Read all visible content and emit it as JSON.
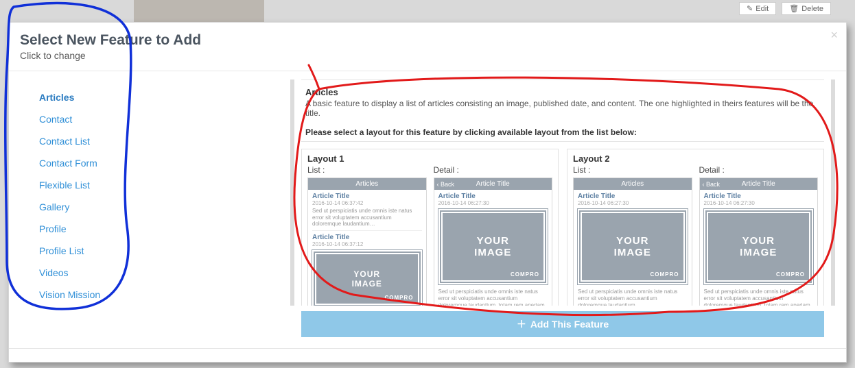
{
  "bg": {
    "edit": "Edit",
    "delete": "Delete"
  },
  "modal": {
    "title": "Select New Feature to Add",
    "subtitle": "Click to change"
  },
  "sidebar": {
    "items": [
      {
        "label": "Articles",
        "active": true
      },
      {
        "label": "Contact"
      },
      {
        "label": "Contact List"
      },
      {
        "label": "Contact Form"
      },
      {
        "label": "Flexible List"
      },
      {
        "label": "Gallery"
      },
      {
        "label": "Profile"
      },
      {
        "label": "Profile List"
      },
      {
        "label": "Videos"
      },
      {
        "label": "Vision Mission"
      }
    ]
  },
  "feature": {
    "name": "Articles",
    "description": "A basic feature to display a list of articles consisting an image, published date, and content. The one highlighted in theirs features will be the title.",
    "instruction": "Please select a layout for this feature by clicking available layout from the list below:"
  },
  "layouts": [
    {
      "title": "Layout 1",
      "list_label": "List :",
      "detail_label": "Detail :",
      "list_header": "Articles",
      "detail_header": "Article Title",
      "back_label": "Back",
      "list_items": [
        {
          "title": "Article Title",
          "date": "2016-10-14 06:37:42",
          "text": "Sed ut perspiciatis unde omnis iste natus error sit voluptatem accusantium doloremque laudantium…"
        },
        {
          "title": "Article Title",
          "date": "2016-10-14 06:37:12"
        }
      ],
      "detail_item": {
        "title": "Article Title",
        "date": "2016-10-14 06:27:30"
      },
      "image_placeholder": "YOUR IMAGE",
      "brand": "COMPRO",
      "detail_text": "Sed ut perspiciatis unde omnis iste natus error sit voluptatem accusantium doloremque laudantium, totam rem aperiam, eaque ipsa quae ab illo inventore veritatis et quasi architecto beatae vitae dicta sunt explicabo. Nemo enim ipsam…"
    },
    {
      "title": "Layout 2",
      "list_label": "List :",
      "detail_label": "Detail :",
      "list_header": "Articles",
      "detail_header": "Article Title",
      "back_label": "Back",
      "list_items": [
        {
          "title": "Article Title",
          "date": "2016-10-14 06:27:30"
        }
      ],
      "detail_item": {
        "title": "Article Title",
        "date": "2016-10-14 06:27:30"
      },
      "image_placeholder": "YOUR IMAGE",
      "brand": "COMPRO",
      "list_text": "Sed ut perspiciatis unde omnis iste natus error sit voluptatem accusantium doloremque laudantium…",
      "detail_text": "Sed ut perspiciatis unde omnis iste natus error sit voluptatem accusantium doloremque laudantium, totam rem aperiam, eaque ipsa quae ab illo inventore veritatis et quasi architecto beatae vitae dicta sunt explicabo. Nemo enim ipsam…"
    }
  ],
  "add_button": "Add This Feature"
}
